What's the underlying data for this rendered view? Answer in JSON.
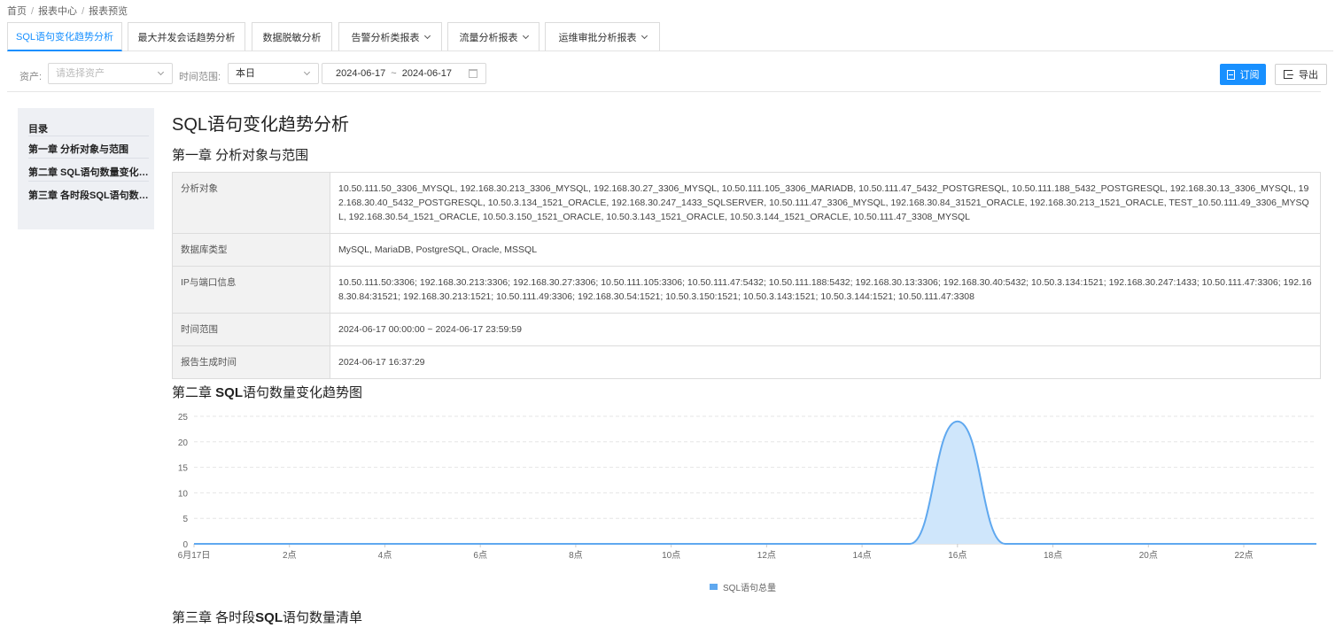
{
  "breadcrumb": [
    "首页",
    "报表中心",
    "报表预览"
  ],
  "tabs": [
    {
      "label": "SQL语句变化趋势分析",
      "active": true
    },
    {
      "label": "最大并发会话趋势分析"
    },
    {
      "label": "数据脱敏分析"
    },
    {
      "label": "告警分析类报表",
      "dropdown": true
    },
    {
      "label": "流量分析报表",
      "dropdown": true
    },
    {
      "label": "运维审批分析报表",
      "dropdown": true
    }
  ],
  "filters": {
    "asset_label": "资产:",
    "asset_placeholder": "请选择资产",
    "time_label": "时间范围:",
    "time_value": "本日",
    "date_start": "2024-06-17",
    "date_sep": "~",
    "date_end": "2024-06-17"
  },
  "actions": {
    "subscribe": "订阅",
    "export": "导出",
    "accent": "#1890ff"
  },
  "toc": {
    "title": "目录",
    "items": [
      "第一章 分析对象与范围",
      "第二章 SQL语句数量变化趋势图",
      "第三章 各时段SQL语句数量清单"
    ]
  },
  "report": {
    "title": "SQL语句变化趋势分析",
    "ch1": "第一章 分析对象与范围",
    "ch2": {
      "prefix": "第二章 ",
      "bold": "SQL",
      "suffix": "语句数量变化趋势图"
    },
    "ch3": {
      "prefix": "第三章 各时段",
      "bold": "SQL",
      "suffix": "语句数量清单"
    }
  },
  "info": [
    {
      "key": "分析对象",
      "value": "10.50.111.50_3306_MYSQL, 192.168.30.213_3306_MYSQL, 192.168.30.27_3306_MYSQL, 10.50.111.105_3306_MARIADB, 10.50.111.47_5432_POSTGRESQL, 10.50.111.188_5432_POSTGRESQL, 192.168.30.13_3306_MYSQL, 192.168.30.40_5432_POSTGRESQL, 10.50.3.134_1521_ORACLE, 192.168.30.247_1433_SQLSERVER, 10.50.111.47_3306_MYSQL, 192.168.30.84_31521_ORACLE, 192.168.30.213_1521_ORACLE, TEST_10.50.111.49_3306_MYSQL, 192.168.30.54_1521_ORACLE, 10.50.3.150_1521_ORACLE, 10.50.3.143_1521_ORACLE, 10.50.3.144_1521_ORACLE, 10.50.111.47_3308_MYSQL"
    },
    {
      "key": "数据库类型",
      "value": "MySQL, MariaDB, PostgreSQL, Oracle, MSSQL"
    },
    {
      "key": "IP与端口信息",
      "value": "10.50.111.50:3306; 192.168.30.213:3306; 192.168.30.27:3306; 10.50.111.105:3306; 10.50.111.47:5432; 10.50.111.188:5432; 192.168.30.13:3306; 192.168.30.40:5432; 10.50.3.134:1521; 192.168.30.247:1433; 10.50.111.47:3306; 192.168.30.84:31521; 192.168.30.213:1521; 10.50.111.49:3306; 192.168.30.54:1521; 10.50.3.150:1521; 10.50.3.143:1521; 10.50.3.144:1521; 10.50.111.47:3308"
    },
    {
      "key": "时间范围",
      "value": "2024-06-17 00:00:00 ~ 2024-06-17 23:59:59"
    },
    {
      "key": "报告生成时间",
      "value": "2024-06-17 16:37:29"
    }
  ],
  "chart_data": {
    "type": "area",
    "x": [
      "6月17日",
      "1点",
      "2点",
      "3点",
      "4点",
      "5点",
      "6点",
      "7点",
      "8点",
      "9点",
      "10点",
      "11点",
      "12点",
      "13点",
      "14点",
      "15点",
      "16点",
      "17点",
      "18点",
      "19点",
      "20点",
      "21点",
      "22点",
      "23点"
    ],
    "x_tick_labels": [
      "6月17日",
      "2点",
      "4点",
      "6点",
      "8点",
      "10点",
      "12点",
      "14点",
      "16点",
      "18点",
      "20点",
      "22点"
    ],
    "series": [
      {
        "name": "SQL语句总量",
        "values": [
          0,
          0,
          0,
          0,
          0,
          0,
          0,
          0,
          0,
          0,
          0,
          0,
          0,
          0,
          0,
          0,
          24,
          0,
          0,
          0,
          0,
          0,
          0,
          0
        ]
      }
    ],
    "ylim": [
      0,
      25
    ],
    "yticks": [
      0,
      5,
      10,
      15,
      20,
      25
    ],
    "grid": true,
    "legend": "bottom-center",
    "color": "#5fa8ef",
    "fill": "#cfe6fb"
  }
}
